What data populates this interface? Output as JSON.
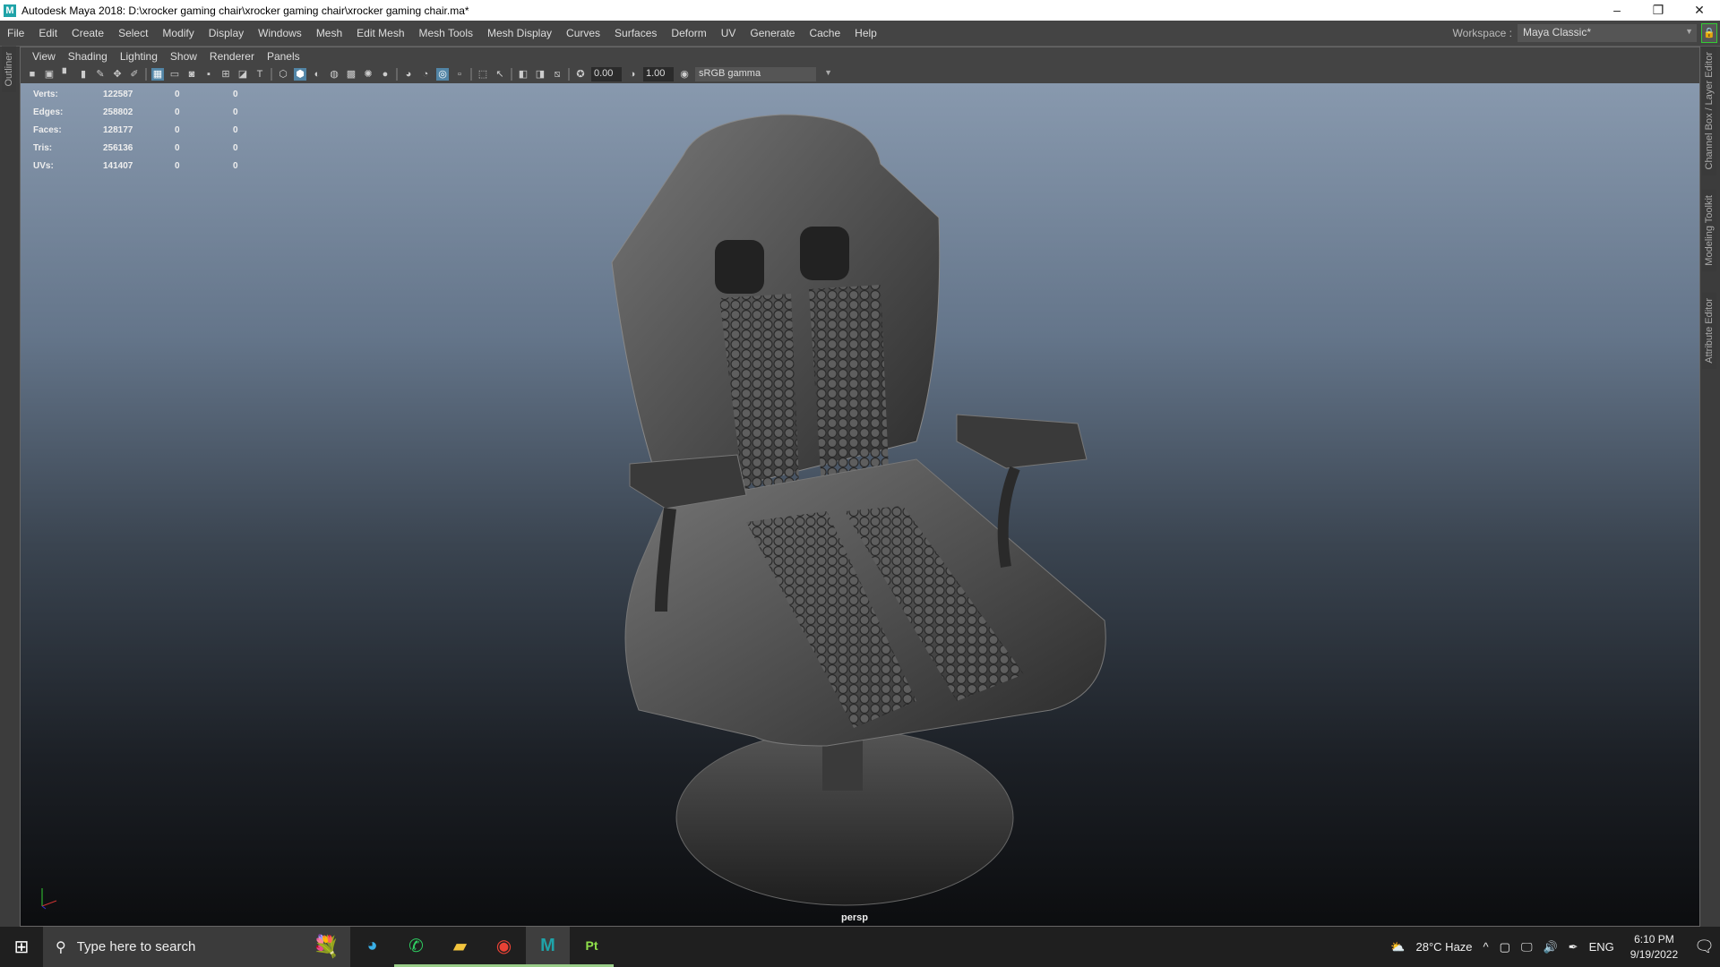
{
  "window": {
    "title": "Autodesk Maya 2018: D:\\xrocker gaming chair\\xrocker gaming chair\\xrocker gaming chair.ma*",
    "logo": "M",
    "minimize": "–",
    "restore": "❐",
    "close": "✕"
  },
  "menu": [
    "File",
    "Edit",
    "Create",
    "Select",
    "Modify",
    "Display",
    "Windows",
    "Mesh",
    "Edit Mesh",
    "Mesh Tools",
    "Mesh Display",
    "Curves",
    "Surfaces",
    "Deform",
    "UV",
    "Generate",
    "Cache",
    "Help"
  ],
  "workspace": {
    "label": "Workspace :",
    "value": "Maya Classic*"
  },
  "side_tabs": {
    "left": "Outliner",
    "right": [
      "Channel Box / Layer Editor",
      "Modeling Toolkit",
      "Attribute Editor"
    ]
  },
  "panel_menu": [
    "View",
    "Shading",
    "Lighting",
    "Show",
    "Renderer",
    "Panels"
  ],
  "toolbar": {
    "exposure": "0.00",
    "gamma": "1.00",
    "color_space": "sRGB gamma"
  },
  "hud": [
    {
      "label": "Verts:",
      "total": "122587",
      "sel": "0",
      "comp": "0"
    },
    {
      "label": "Edges:",
      "total": "258802",
      "sel": "0",
      "comp": "0"
    },
    {
      "label": "Faces:",
      "total": "128177",
      "sel": "0",
      "comp": "0"
    },
    {
      "label": "Tris:",
      "total": "256136",
      "sel": "0",
      "comp": "0"
    },
    {
      "label": "UVs:",
      "total": "141407",
      "sel": "0",
      "comp": "0"
    }
  ],
  "camera": "persp",
  "taskbar": {
    "search_placeholder": "Type here to search",
    "weather": "28°C  Haze",
    "lang": "ENG",
    "time": "6:10 PM",
    "date": "9/19/2022",
    "apps": [
      "edge",
      "whatsapp",
      "file-explorer",
      "chrome",
      "maya",
      "painter"
    ],
    "painter_label": "Pt",
    "maya_label": "M"
  }
}
